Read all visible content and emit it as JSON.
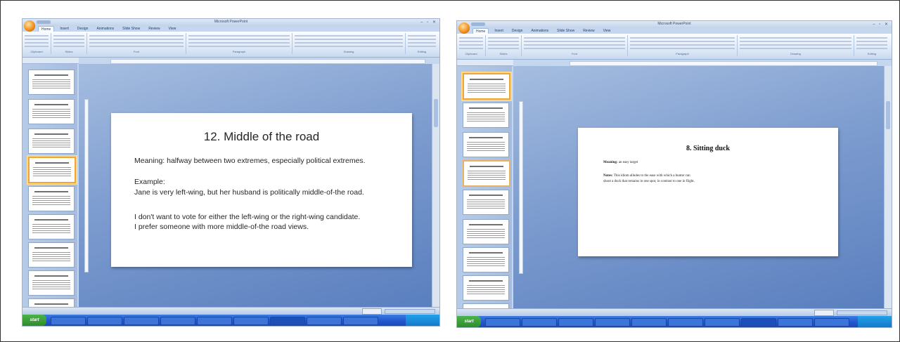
{
  "left_window": {
    "app": "Microsoft PowerPoint",
    "tabs": [
      "Home",
      "Insert",
      "Design",
      "Animations",
      "Slide Show",
      "Review",
      "View"
    ],
    "ribbon_groups": [
      "Clipboard",
      "Slides",
      "Font",
      "Paragraph",
      "Drawing",
      "Editing"
    ],
    "pane_tabs": [
      "Slides",
      "Outline"
    ],
    "slide": {
      "title": "12. Middle of the road",
      "meaning": "Meaning: halfway between two extremes, especially political extremes.",
      "example_label": "Example:",
      "example_1": "Jane is very left-wing, but her husband is politically middle-of-the road.",
      "example_2_line1": "I don't want to vote for either the left-wing or the right-wing candidate.",
      "example_2_line2": "I prefer someone with more middle-of-the road views."
    },
    "taskbar_start": "start"
  },
  "right_window": {
    "app": "Microsoft PowerPoint",
    "tabs": [
      "Home",
      "Insert",
      "Design",
      "Animations",
      "Slide Show",
      "Review",
      "View"
    ],
    "ribbon_groups": [
      "Clipboard",
      "Slides",
      "Font",
      "Paragraph",
      "Drawing",
      "Editing"
    ],
    "pane_tabs": [
      "Slides",
      "Outline"
    ],
    "slide": {
      "title": "8. Sitting duck",
      "meaning_label": "Meaning:",
      "meaning_text": "an easy target",
      "notes_label": "Notes:",
      "notes_line1": "This idiom alludes to the ease with which a hunter can",
      "notes_line2": "shoot a duck that remains in one spot, in contrast to one in flight."
    },
    "taskbar_start": "start"
  },
  "colors": {
    "editor_bg": "#7d9ccf",
    "ribbon_bg": "#dbe7f6",
    "selected_thumb": "#f0a534",
    "taskbar": "#245ad0"
  }
}
